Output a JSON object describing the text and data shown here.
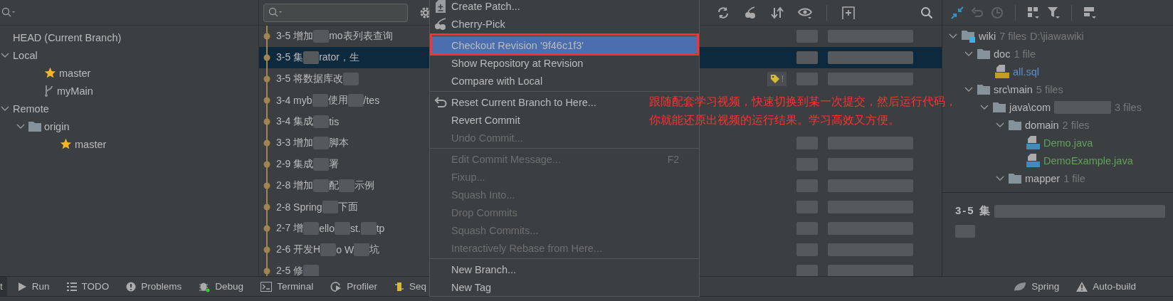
{
  "branches_panel": {
    "tree": [
      {
        "label": "HEAD (Current Branch)",
        "kind": "head"
      },
      {
        "label": "Local",
        "kind": "group",
        "expanded": true,
        "children": [
          {
            "label": "master",
            "kind": "favorite"
          },
          {
            "label": "myMain",
            "kind": "branch"
          }
        ]
      },
      {
        "label": "Remote",
        "kind": "group",
        "expanded": true,
        "children": [
          {
            "label": "origin",
            "kind": "folder",
            "expanded": true,
            "children": [
              {
                "label": "master",
                "kind": "favorite"
              }
            ]
          }
        ]
      }
    ]
  },
  "commits": [
    {
      "parts": [
        "3-5 增加",
        "mo表列表查询"
      ],
      "selected": false
    },
    {
      "parts": [
        "3-5 集",
        "rator，生"
      ],
      "selected": true
    },
    {
      "parts": [
        "3-5 将数据库改"
      ],
      "selected": false
    },
    {
      "parts": [
        "3-4 myb",
        "使用",
        "/tes"
      ],
      "selected": false
    },
    {
      "parts": [
        "3-4 集成",
        "tis"
      ],
      "selected": false
    },
    {
      "parts": [
        "3-3 增加",
        "脚本"
      ],
      "selected": false
    },
    {
      "parts": [
        "2-9 集成",
        "署"
      ],
      "selected": false
    },
    {
      "parts": [
        "2-8 增加",
        "配",
        "示例"
      ],
      "selected": false
    },
    {
      "parts": [
        "2-8 Spring",
        "下面"
      ],
      "selected": false
    },
    {
      "parts": [
        "2-7 增",
        "ello",
        "st.",
        "tp"
      ],
      "selected": false
    },
    {
      "parts": [
        "2-6 开发H",
        "o W",
        "坑"
      ],
      "selected": false
    },
    {
      "parts": [
        "2-5 修"
      ],
      "selected": false
    }
  ],
  "commit_tag": {
    "text": "!"
  },
  "context_menu": {
    "items": [
      {
        "kind": "item",
        "label": "Create Patch...",
        "disabled": false,
        "selected": false
      },
      {
        "kind": "item",
        "label": "Cherry-Pick",
        "disabled": false,
        "selected": false
      },
      {
        "kind": "separator"
      },
      {
        "kind": "item",
        "label": "Checkout Revision '9f46c1f3'",
        "disabled": false,
        "selected": true
      },
      {
        "kind": "item",
        "label": "Show Repository at Revision",
        "disabled": false,
        "selected": false
      },
      {
        "kind": "item",
        "label": "Compare with Local",
        "disabled": false,
        "selected": false
      },
      {
        "kind": "separator"
      },
      {
        "kind": "item",
        "label": "Reset Current Branch to Here...",
        "disabled": false,
        "selected": false
      },
      {
        "kind": "item",
        "label": "Revert Commit",
        "disabled": false,
        "selected": false
      },
      {
        "kind": "item",
        "label": "Undo Commit...",
        "disabled": true,
        "selected": false
      },
      {
        "kind": "separator"
      },
      {
        "kind": "item",
        "label": "Edit Commit Message...",
        "disabled": true,
        "selected": false,
        "shortcut": "F2"
      },
      {
        "kind": "item",
        "label": "Fixup...",
        "disabled": true,
        "selected": false
      },
      {
        "kind": "item",
        "label": "Squash Into...",
        "disabled": true,
        "selected": false
      },
      {
        "kind": "item",
        "label": "Drop Commits",
        "disabled": true,
        "selected": false
      },
      {
        "kind": "item",
        "label": "Squash Commits...",
        "disabled": true,
        "selected": false
      },
      {
        "kind": "item",
        "label": "Interactively Rebase from Here...",
        "disabled": true,
        "selected": false
      },
      {
        "kind": "separator"
      },
      {
        "kind": "item",
        "label": "New Branch...",
        "disabled": false,
        "selected": false
      },
      {
        "kind": "item",
        "label": "New Tag",
        "disabled": false,
        "selected": false
      }
    ]
  },
  "annotation": {
    "lines": [
      "跟随配套学习视频，快速切换到某一次提交，然后运行代码，",
      "你就能还原出视频的运行结果。学习高效又方便。"
    ]
  },
  "file_tree": [
    {
      "kind": "module",
      "name": "wiki",
      "count": "7 files",
      "path": "D:\\jiawawiki",
      "expanded": true,
      "children": [
        {
          "kind": "folder",
          "name": "doc",
          "count": "1 file",
          "expanded": true,
          "children": [
            {
              "kind": "sql",
              "name": "all.sql",
              "color": "#5b8fc9"
            }
          ]
        },
        {
          "kind": "folder",
          "name": "src\\main",
          "count": "5 files",
          "expanded": true,
          "children": [
            {
              "kind": "folder",
              "name": "java\\com",
              "count": "3 files",
              "expanded": true,
              "children": [
                {
                  "kind": "folder",
                  "name": "domain",
                  "count": "2 files",
                  "expanded": true,
                  "children": [
                    {
                      "kind": "java",
                      "name": "Demo.java",
                      "color": "#62a05a"
                    },
                    {
                      "kind": "java",
                      "name": "DemoExample.java",
                      "color": "#62a05a"
                    }
                  ]
                },
                {
                  "kind": "folder",
                  "name": "mapper",
                  "count": "1 file",
                  "expanded": true
                }
              ]
            }
          ]
        }
      ]
    }
  ],
  "details": {
    "title": "3-5 集"
  },
  "tool_windows_left": [
    {
      "label": "t"
    },
    {
      "label": "Run"
    },
    {
      "label": "TODO"
    },
    {
      "label": "Problems"
    },
    {
      "label": "Debug"
    },
    {
      "label": "Terminal"
    },
    {
      "label": "Profiler"
    },
    {
      "label": "Seq"
    }
  ],
  "tool_windows_right": [
    {
      "label": "Spring"
    },
    {
      "label": "Auto-build"
    }
  ]
}
